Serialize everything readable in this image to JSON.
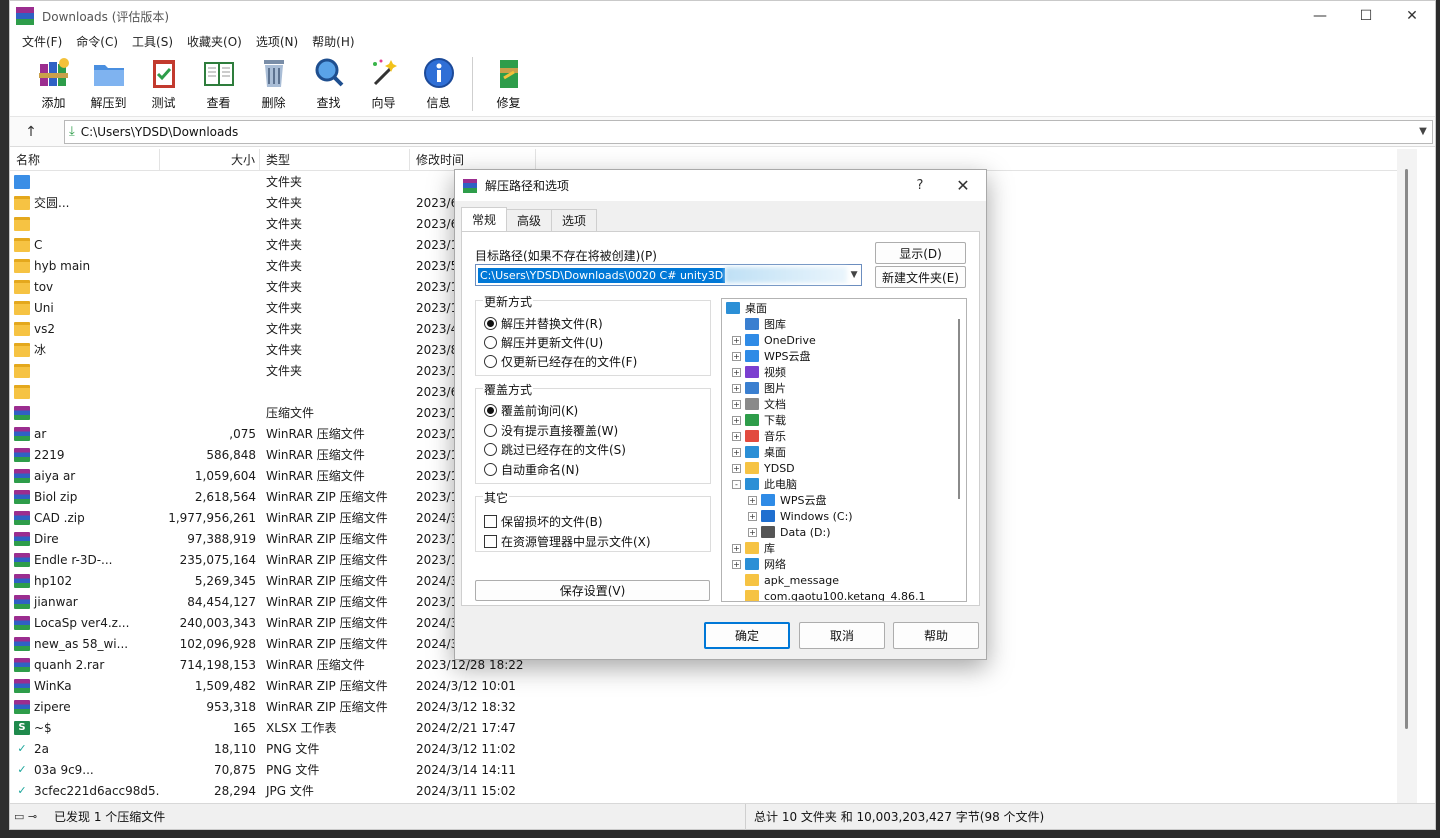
{
  "window": {
    "title": "Downloads (评估版本)",
    "controls": [
      "—",
      "☐",
      "✕"
    ]
  },
  "menu": [
    "文件(F)",
    "命令(C)",
    "工具(S)",
    "收藏夹(O)",
    "选项(N)",
    "帮助(H)"
  ],
  "toolbar": [
    {
      "label": "添加",
      "icon": "books-stack-icon"
    },
    {
      "label": "解压到",
      "icon": "folder-extract-icon"
    },
    {
      "label": "测试",
      "icon": "clipboard-check-icon"
    },
    {
      "label": "查看",
      "icon": "open-book-icon"
    },
    {
      "label": "删除",
      "icon": "trash-icon"
    },
    {
      "label": "查找",
      "icon": "magnifier-icon"
    },
    {
      "label": "向导",
      "icon": "magic-wand-icon"
    },
    {
      "label": "信息",
      "icon": "info-icon"
    },
    {
      "label": "修复",
      "icon": "repair-icon"
    }
  ],
  "path": {
    "value": "C:\\Users\\YDSD\\Downloads"
  },
  "columns": {
    "name": "名称",
    "size": "大小",
    "type": "类型",
    "modified": "修改时间"
  },
  "files": [
    {
      "name": "",
      "size": "",
      "type": "文件夹",
      "date": "",
      "icon": "drive"
    },
    {
      "name": "交圆...",
      "size": "",
      "type": "文件夹",
      "date": "2023/6",
      "icon": "folder"
    },
    {
      "name": "",
      "size": "",
      "type": "文件夹",
      "date": "2023/6",
      "icon": "folder"
    },
    {
      "name": "C",
      "size": "",
      "type": "文件夹",
      "date": "2023/1",
      "icon": "folder"
    },
    {
      "name": "hyb        main",
      "size": "",
      "type": "文件夹",
      "date": "2023/5",
      "icon": "folder"
    },
    {
      "name": "tov",
      "size": "",
      "type": "文件夹",
      "date": "2023/1",
      "icon": "folder"
    },
    {
      "name": "Uni",
      "size": "",
      "type": "文件夹",
      "date": "2023/1",
      "icon": "folder"
    },
    {
      "name": "vs2",
      "size": "",
      "type": "文件夹",
      "date": "2023/4",
      "icon": "folder"
    },
    {
      "name": "冰",
      "size": "",
      "type": "文件夹",
      "date": "2023/8",
      "icon": "folder"
    },
    {
      "name": "",
      "size": "",
      "type": "文件夹",
      "date": "2023/1",
      "icon": "folder"
    },
    {
      "name": "",
      "size": "",
      "type": "",
      "date": "2023/6",
      "icon": "folder"
    },
    {
      "name": "",
      "size": "",
      "type": "压缩文件",
      "date": "2023/1",
      "icon": "rar"
    },
    {
      "name": "ar",
      "size": ",075",
      "type": "WinRAR 压缩文件",
      "date": "2023/1",
      "icon": "rar"
    },
    {
      "name": "2219",
      "size": "586,848",
      "type": "WinRAR 压缩文件",
      "date": "2023/1",
      "icon": "rar"
    },
    {
      "name": "aiya          ar",
      "size": "1,059,604",
      "type": "WinRAR 压缩文件",
      "date": "2023/1",
      "icon": "rar"
    },
    {
      "name": "Biol          zip",
      "size": "2,618,564",
      "type": "WinRAR ZIP 压缩文件",
      "date": "2023/1",
      "icon": "rar"
    },
    {
      "name": "CAD         .zip",
      "size": "1,977,956,261",
      "type": "WinRAR ZIP 压缩文件",
      "date": "2024/3",
      "icon": "rar"
    },
    {
      "name": "Dire",
      "size": "97,388,919",
      "type": "WinRAR ZIP 压缩文件",
      "date": "2023/1",
      "icon": "rar"
    },
    {
      "name": "Endle          r-3D-...",
      "size": "235,075,164",
      "type": "WinRAR ZIP 压缩文件",
      "date": "2023/1",
      "icon": "rar"
    },
    {
      "name": "hp102",
      "size": "5,269,345",
      "type": "WinRAR ZIP 压缩文件",
      "date": "2024/3",
      "icon": "rar"
    },
    {
      "name": "jianwar",
      "size": "84,454,127",
      "type": "WinRAR ZIP 压缩文件",
      "date": "2023/1",
      "icon": "rar"
    },
    {
      "name": "LocaSp          ver4.z...",
      "size": "240,003,343",
      "type": "WinRAR ZIP 压缩文件",
      "date": "2024/3",
      "icon": "rar"
    },
    {
      "name": "new_as        58_wi...",
      "size": "102,096,928",
      "type": "WinRAR ZIP 压缩文件",
      "date": "2024/3",
      "icon": "rar"
    },
    {
      "name": "quanh          2.rar",
      "size": "714,198,153",
      "type": "WinRAR 压缩文件",
      "date": "2023/12/28 18:22",
      "icon": "rar"
    },
    {
      "name": "WinKa",
      "size": "1,509,482",
      "type": "WinRAR ZIP 压缩文件",
      "date": "2024/3/12 10:01",
      "icon": "rar"
    },
    {
      "name": "zipere",
      "size": "953,318",
      "type": "WinRAR ZIP 压缩文件",
      "date": "2024/3/12 18:32",
      "icon": "rar"
    },
    {
      "name": "~$",
      "size": "165",
      "type": "XLSX 工作表",
      "date": "2024/2/21 17:47",
      "icon": "xlsx"
    },
    {
      "name": "2a",
      "size": "18,110",
      "type": "PNG 文件",
      "date": "2024/3/12 11:02",
      "icon": "png"
    },
    {
      "name": "03a          9c9...",
      "size": "70,875",
      "type": "PNG 文件",
      "date": "2024/3/14 14:11",
      "icon": "png"
    },
    {
      "name": "3cfec221d6acc98d5...",
      "size": "28,294",
      "type": "JPG 文件",
      "date": "2024/3/11 15:02",
      "icon": "png"
    }
  ],
  "status": {
    "left": "已发现 1 个压缩文件",
    "right": "总计 10 文件夹 和 10,003,203,427 字节(98 个文件)"
  },
  "dialog": {
    "title": "解压路径和选项",
    "help": "?",
    "close": "✕",
    "tabs": [
      "常规",
      "高级",
      "选项"
    ],
    "dest_label": "目标路径(如果不存在将被创建)(P)",
    "dest_value": "C:\\Users\\YDSD\\Downloads\\0020 C# unity3D",
    "show_button": "显示(D)",
    "new_folder_button": "新建文件夹(E)",
    "update_group": {
      "title": "更新方式",
      "options": [
        "解压并替换文件(R)",
        "解压并更新文件(U)",
        "仅更新已经存在的文件(F)"
      ],
      "selected": 0
    },
    "overwrite_group": {
      "title": "覆盖方式",
      "options": [
        "覆盖前询问(K)",
        "没有提示直接覆盖(W)",
        "跳过已经存在的文件(S)",
        "自动重命名(N)"
      ],
      "selected": 0
    },
    "misc_group": {
      "title": "其它",
      "options": [
        "保留损坏的文件(B)",
        "在资源管理器中显示文件(X)"
      ]
    },
    "save_button": "保存设置(V)",
    "tree": [
      {
        "label": "桌面",
        "level": 0,
        "exp": "",
        "icon": "desktop"
      },
      {
        "label": "图库",
        "level": 1,
        "exp": "",
        "icon": "gallery"
      },
      {
        "label": "OneDrive",
        "level": 1,
        "exp": "+",
        "icon": "cloud"
      },
      {
        "label": "WPS云盘",
        "level": 1,
        "exp": "+",
        "icon": "cloud"
      },
      {
        "label": "视频",
        "level": 1,
        "exp": "+",
        "icon": "video"
      },
      {
        "label": "图片",
        "level": 1,
        "exp": "+",
        "icon": "gallery"
      },
      {
        "label": "文档",
        "level": 1,
        "exp": "+",
        "icon": "doc"
      },
      {
        "label": "下载",
        "level": 1,
        "exp": "+",
        "icon": "download"
      },
      {
        "label": "音乐",
        "level": 1,
        "exp": "+",
        "icon": "music"
      },
      {
        "label": "桌面",
        "level": 1,
        "exp": "+",
        "icon": "desktop"
      },
      {
        "label": "YDSD",
        "level": 1,
        "exp": "+",
        "icon": "folder"
      },
      {
        "label": "此电脑",
        "level": 1,
        "exp": "-",
        "icon": "pc"
      },
      {
        "label": "WPS云盘",
        "level": 2,
        "exp": "+",
        "icon": "cloud"
      },
      {
        "label": "Windows (C:)",
        "level": 2,
        "exp": "+",
        "icon": "windows"
      },
      {
        "label": "Data (D:)",
        "level": 2,
        "exp": "+",
        "icon": "drive"
      },
      {
        "label": "库",
        "level": 1,
        "exp": "+",
        "icon": "folder"
      },
      {
        "label": "网络",
        "level": 1,
        "exp": "+",
        "icon": "network"
      },
      {
        "label": "apk_message",
        "level": 1,
        "exp": "",
        "icon": "folder"
      },
      {
        "label": "com.gaotu100.ketang_4.86.1",
        "level": 1,
        "exp": "",
        "icon": "folder"
      }
    ],
    "ok": "确定",
    "cancel": "取消",
    "help_button": "帮助"
  },
  "colors": {
    "accent": "#0078d7",
    "folder": "#f6c343",
    "rar_purple": "#9b2d8f",
    "rar_blue": "#2f61c4",
    "rar_green": "#2e9d4a"
  }
}
